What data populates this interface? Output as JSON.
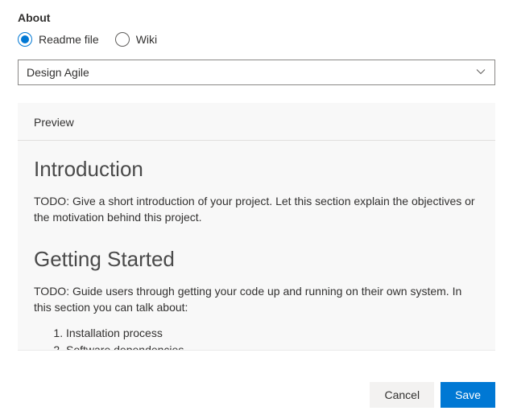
{
  "section_title": "About",
  "radios": {
    "readme": {
      "label": "Readme file",
      "selected": true
    },
    "wiki": {
      "label": "Wiki",
      "selected": false
    }
  },
  "dropdown": {
    "selected": "Design Agile"
  },
  "preview": {
    "header": "Preview",
    "sections": [
      {
        "heading": "Introduction",
        "paragraph": "TODO: Give a short introduction of your project. Let this section explain the objectives or the motivation behind this project."
      },
      {
        "heading": "Getting Started",
        "paragraph": "TODO: Guide users through getting your code up and running on their own system. In this section you can talk about:",
        "list": [
          "Installation process",
          "Software dependencies"
        ]
      }
    ]
  },
  "footer": {
    "cancel": "Cancel",
    "save": "Save"
  }
}
